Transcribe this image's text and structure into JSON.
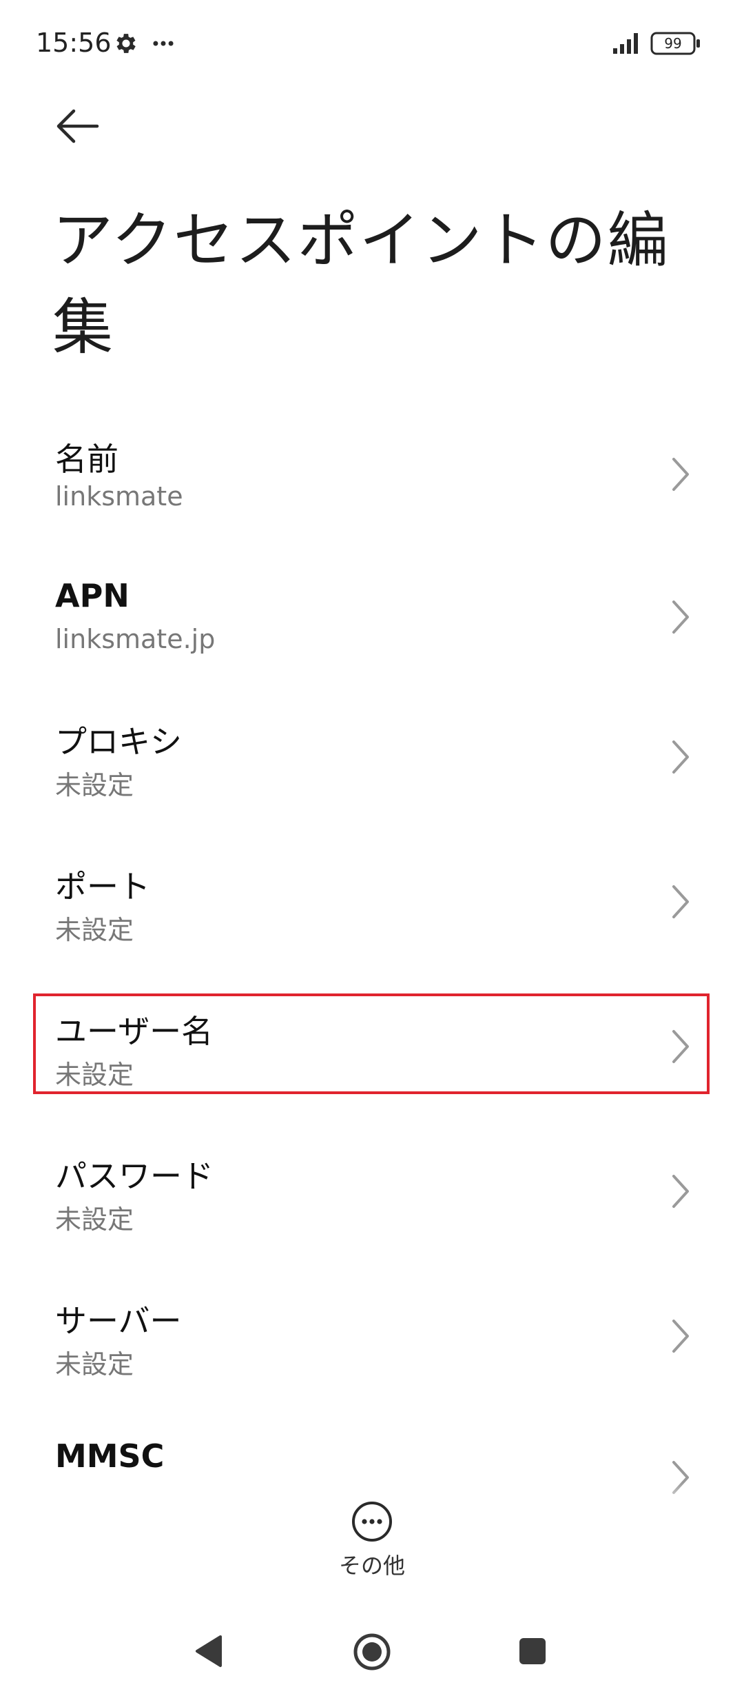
{
  "status_bar": {
    "time": "15:56",
    "battery": "99",
    "icons": [
      "gear-icon",
      "more-dots-icon",
      "signal-icon",
      "battery-icon"
    ]
  },
  "header": {
    "back_icon": "arrow-left-icon",
    "title": "アクセスポイントの編集"
  },
  "settings": [
    {
      "label": "名前",
      "value": "linksmate"
    },
    {
      "label": "APN",
      "value": "linksmate.jp"
    },
    {
      "label": "プロキシ",
      "value": "未設定"
    },
    {
      "label": "ポート",
      "value": "未設定"
    },
    {
      "label": "ユーザー名",
      "value": "未設定",
      "highlighted": true
    },
    {
      "label": "パスワード",
      "value": "未設定"
    },
    {
      "label": "サーバー",
      "value": "未設定"
    },
    {
      "label": "MMSC",
      "value": ""
    }
  ],
  "bottom_action": {
    "label": "その他",
    "icon": "more-circle-icon"
  },
  "navigation_bar": {
    "icons": [
      "nav-back-icon",
      "nav-home-icon",
      "nav-recents-icon"
    ]
  },
  "colors": {
    "highlight": "#e0242e",
    "secondary_text": "#777777",
    "chevron": "#9a9a9a"
  }
}
